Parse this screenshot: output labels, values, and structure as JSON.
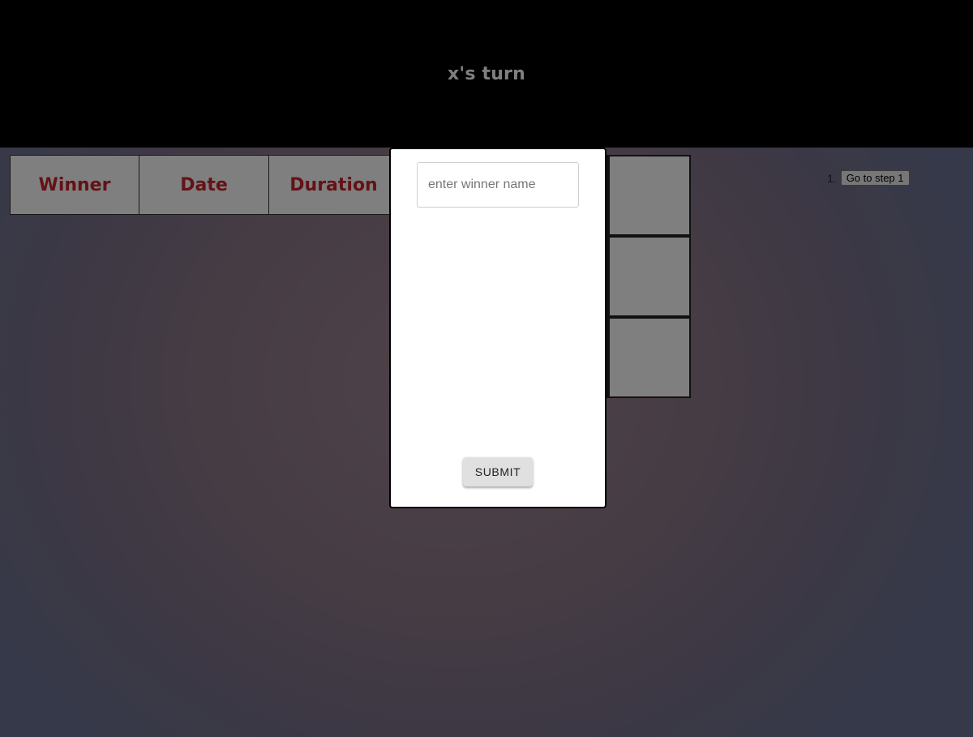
{
  "status": {
    "turn_text": "x's turn"
  },
  "history_table": {
    "headers": [
      "Winner",
      "Date",
      "Duration"
    ]
  },
  "moves": [
    {
      "number": "1.",
      "label": "Go to step 1"
    }
  ],
  "modal": {
    "input_placeholder": "enter winner name",
    "input_value": "",
    "submit_label": "SUBMIT"
  },
  "colors": {
    "header_text": "#c9252d",
    "status_bar": "#000000"
  }
}
